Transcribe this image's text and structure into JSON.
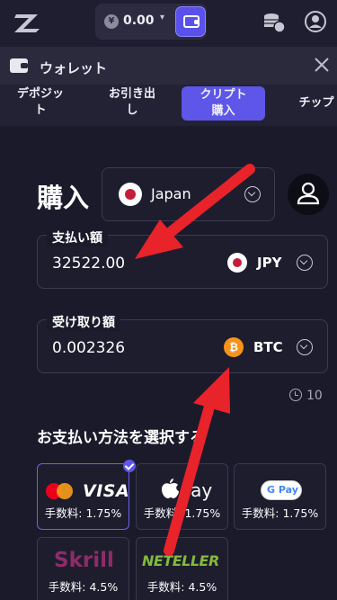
{
  "topbar": {
    "balance_currency": "¥",
    "balance_value": "0.00",
    "caret": "▾",
    "icons": [
      "logo-icon",
      "yen-icon",
      "wallet-icon",
      "coins-icon",
      "user-icon"
    ]
  },
  "wallet_header": {
    "title": "ウォレット",
    "icons": [
      "wallet-icon",
      "close-icon"
    ]
  },
  "tabs": [
    {
      "label_line1": "デポジッ",
      "label_line2": "ト",
      "active": false
    },
    {
      "label_line1": "お引き出",
      "label_line2": "し",
      "active": false
    },
    {
      "label_line1": "クリプト",
      "label_line2": "購入",
      "active": true
    },
    {
      "label_line1": "チップ",
      "label_line2": "",
      "active": false
    }
  ],
  "main": {
    "title": "購入",
    "country": "Japan",
    "pay": {
      "label": "支払い額",
      "value": "32522.00",
      "currency": "JPY"
    },
    "receive": {
      "label": "受け取り額",
      "value": "0.002326",
      "currency": "BTC",
      "currency_symbol": "₿"
    },
    "timer": "10",
    "section_title": "お支払い方法を選択する",
    "payment_methods": [
      {
        "name": "VISA",
        "brand": "Mastercard/VISA",
        "fee": "手数料: 1.75%",
        "selected": true
      },
      {
        "name": "Pay",
        "brand": "Apple Pay",
        "fee": "手数料: 1.75%",
        "selected": false
      },
      {
        "name": "G Pay",
        "brand": "Google Pay",
        "fee": "手数料: 1.75%",
        "selected": false
      },
      {
        "name": "Skrill",
        "brand": "Skrill",
        "fee": "手数料: 4.5%",
        "selected": false
      },
      {
        "name": "NETELLER",
        "brand": "Neteller",
        "fee": "手数料: 4.5%",
        "selected": false
      }
    ]
  },
  "colors": {
    "background": "#1b1a2b",
    "accent": "#5e56e8",
    "annotation_arrow": "#e8232a",
    "jp_red": "#c41e3a",
    "btc_orange": "#f7931a"
  }
}
